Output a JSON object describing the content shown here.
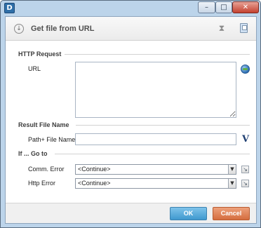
{
  "titlebar": {
    "app_icon": "D",
    "buttons": [
      {
        "name": "minimize",
        "glyph": "–"
      },
      {
        "name": "maximize",
        "glyph": "□"
      },
      {
        "name": "close",
        "glyph": "✕"
      }
    ]
  },
  "header": {
    "title": "Get file from URL",
    "left_icon": "download-icon",
    "right_icons": [
      "hourglass-icon",
      "notes-icon"
    ]
  },
  "sections": {
    "http_request": {
      "title": "HTTP Request",
      "url_label": "URL",
      "url_value": "",
      "url_action_icon": "globe-icon"
    },
    "result_file_name": {
      "title": "Result File Name",
      "path_label": "Path+ File Name",
      "path_value": "",
      "variable_button_label": "V"
    },
    "if_go_to": {
      "title": "If ... Go to",
      "comm_error_label": "Comm. Error",
      "comm_error_value": "<Continue>",
      "http_error_label": "Http Error",
      "http_error_value": "<Continue>"
    }
  },
  "footer": {
    "ok_label": "OK",
    "cancel_label": "Cancel"
  },
  "colors": {
    "window_frame": "#bcd4ea",
    "ok_button": "#4ea3d6",
    "cancel_button": "#df7b4d"
  }
}
